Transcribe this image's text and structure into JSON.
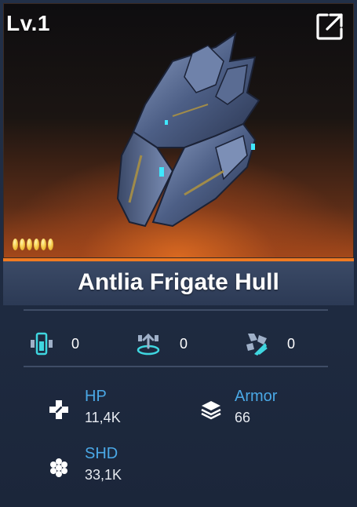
{
  "item": {
    "level": "Lv.1",
    "name": "Antlia Frigate Hull",
    "rarity_pips": 6
  },
  "counters": [
    {
      "icon": "module-slot-icon",
      "value": "0"
    },
    {
      "icon": "upgrade-slot-icon",
      "value": "0"
    },
    {
      "icon": "shard-icon",
      "value": "0"
    }
  ],
  "attributes": {
    "hp": {
      "label": "HP",
      "value": "11,4K",
      "icon": "plus-cross-icon"
    },
    "armor": {
      "label": "Armor",
      "value": "66",
      "icon": "layers-icon"
    },
    "shd": {
      "label": "SHD",
      "value": "33,1K",
      "icon": "hexagon-cluster-icon"
    }
  },
  "colors": {
    "accent_orange": "#f07a22",
    "attr_label_blue": "#4aa8e6",
    "icon_teal": "#3fd6e0"
  }
}
